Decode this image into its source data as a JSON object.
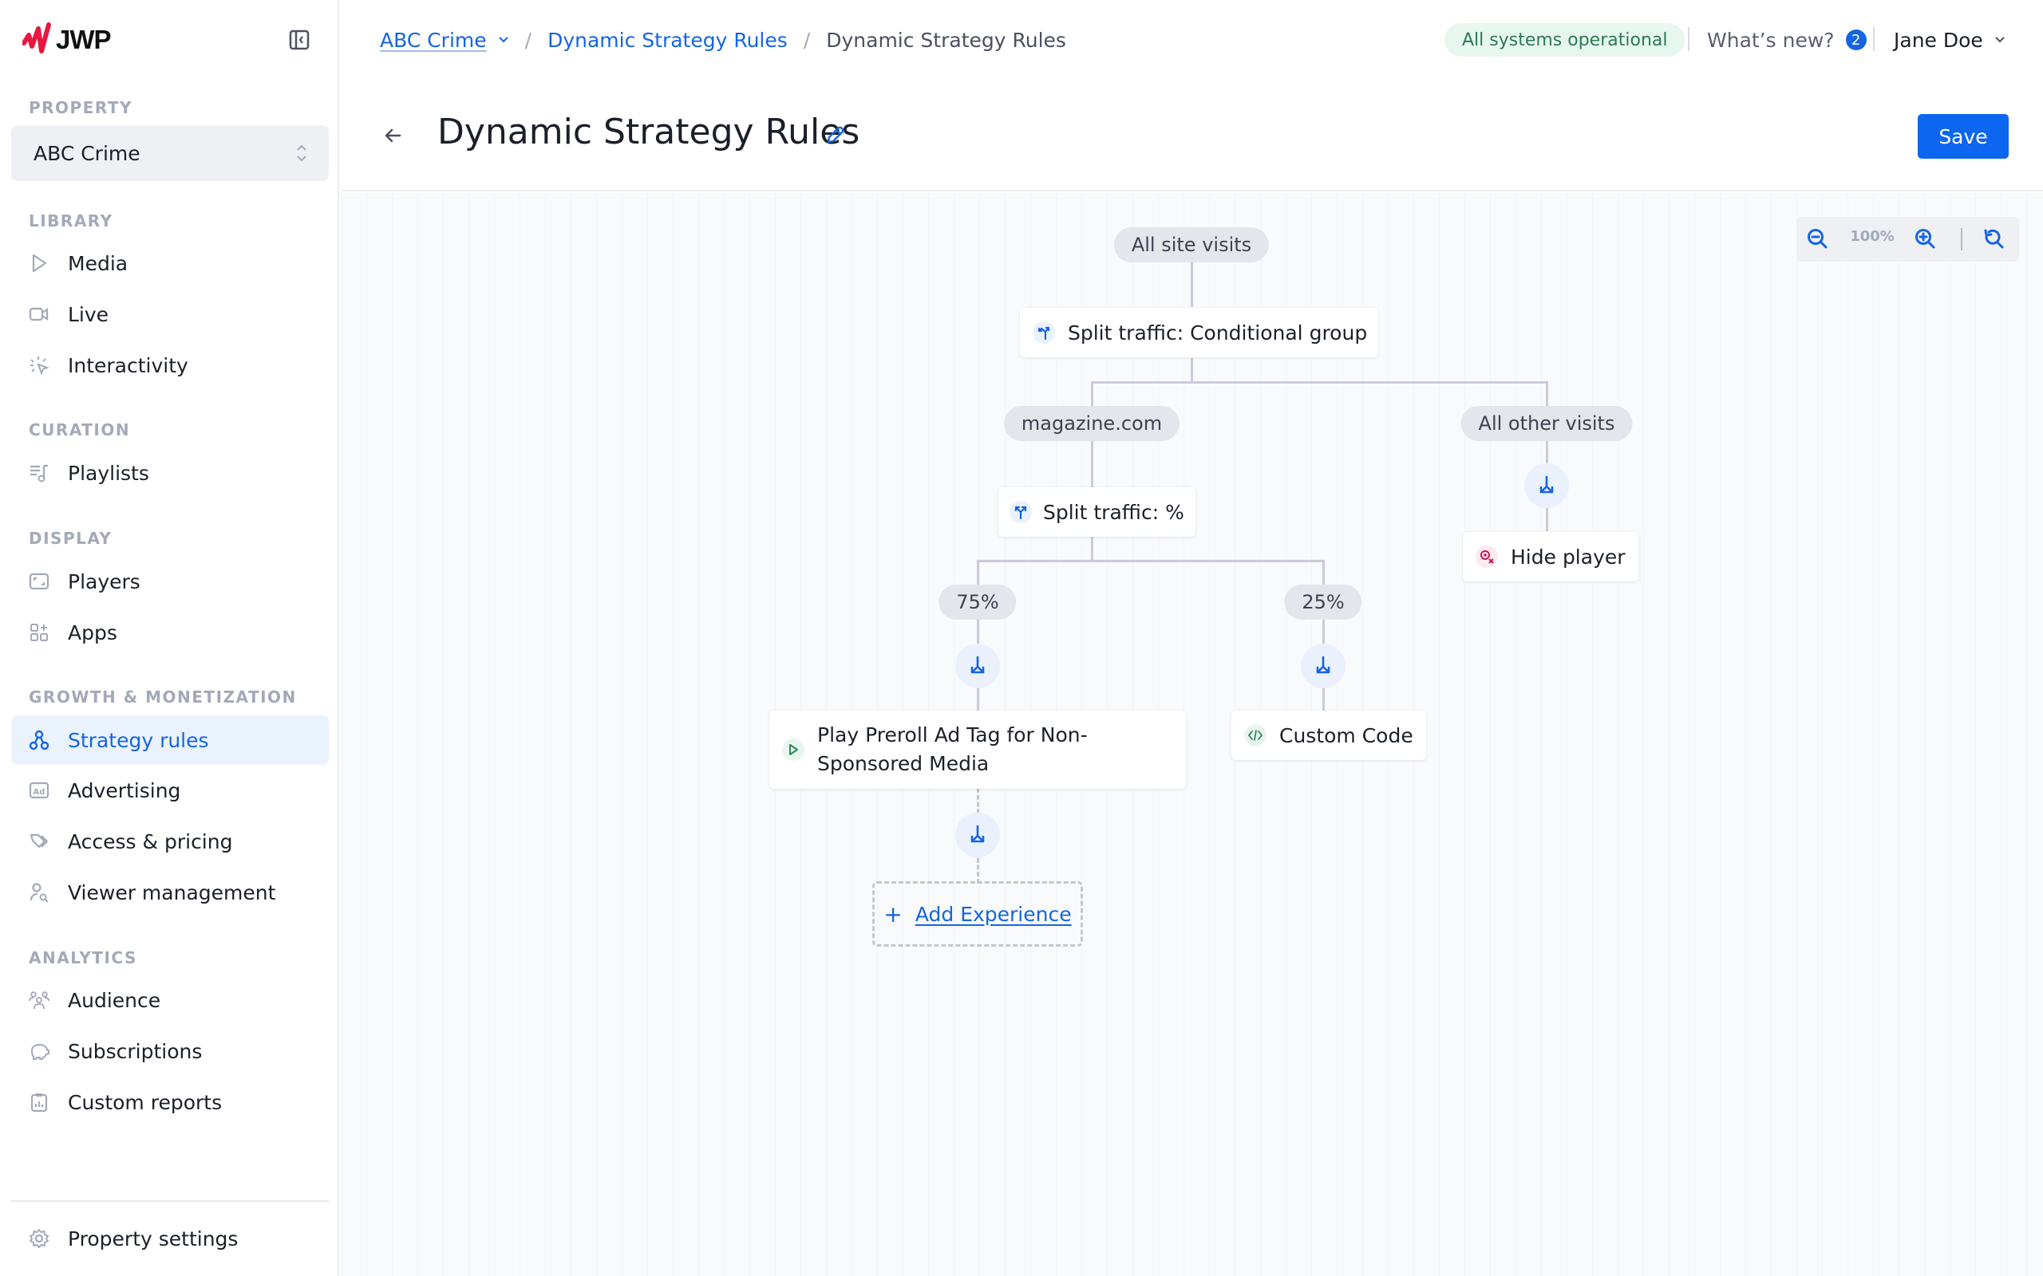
{
  "app": {
    "brand": "JWP",
    "brand_color": "#e8173f",
    "accent_color": "#1565e0"
  },
  "sidebar": {
    "property_label": "PROPERTY",
    "property_value": "ABC Crime",
    "sections": [
      {
        "label": "LIBRARY",
        "items": [
          {
            "label": "Media",
            "icon": "play-icon"
          },
          {
            "label": "Live",
            "icon": "video-camera-icon"
          },
          {
            "label": "Interactivity",
            "icon": "click-sparkle-icon"
          }
        ]
      },
      {
        "label": "CURATION",
        "items": [
          {
            "label": "Playlists",
            "icon": "playlist-icon"
          }
        ]
      },
      {
        "label": "DISPLAY",
        "items": [
          {
            "label": "Players",
            "icon": "player-frame-icon"
          },
          {
            "label": "Apps",
            "icon": "apps-grid-icon"
          }
        ]
      },
      {
        "label": "GROWTH & MONETIZATION",
        "items": [
          {
            "label": "Strategy rules",
            "icon": "hierarchy-icon",
            "active": true
          },
          {
            "label": "Advertising",
            "icon": "ad-icon"
          },
          {
            "label": "Access & pricing",
            "icon": "tags-icon"
          },
          {
            "label": "Viewer management",
            "icon": "user-search-icon"
          }
        ]
      },
      {
        "label": "ANALYTICS",
        "items": [
          {
            "label": "Audience",
            "icon": "users-icon"
          },
          {
            "label": "Subscriptions",
            "icon": "piggy-bank-icon"
          },
          {
            "label": "Custom reports",
            "icon": "clipboard-chart-icon"
          }
        ]
      }
    ],
    "footer_item": {
      "label": "Property settings",
      "icon": "gear-icon"
    }
  },
  "header": {
    "breadcrumb": [
      {
        "label": "ABC Crime",
        "type": "dropdown-link"
      },
      {
        "label": "Dynamic Strategy Rules",
        "type": "link"
      },
      {
        "label": "Dynamic Strategy Rules",
        "type": "current"
      }
    ],
    "status": "All systems operational",
    "whats_new": "What’s new?",
    "whats_new_count": "2",
    "user_name": "Jane Doe",
    "page_title": "Dynamic Strategy Rules",
    "save_label": "Save"
  },
  "canvas": {
    "zoom_level": "100%",
    "root": "All site visits",
    "conditional_split": "Split traffic: Conditional group",
    "branches": {
      "left_condition": "magazine.com",
      "right_condition": "All other visits",
      "percent_split": "Split traffic: %",
      "left_percent": "75%",
      "right_percent": "25%",
      "experience_left": "Play Preroll Ad Tag for Non-Sponsored Media",
      "experience_left_line1": "Play Preroll Ad Tag for Non-",
      "experience_left_line2": "Sponsored Media",
      "experience_right": "Custom Code",
      "experience_other": "Hide player",
      "add_experience": "Add Experience"
    }
  }
}
